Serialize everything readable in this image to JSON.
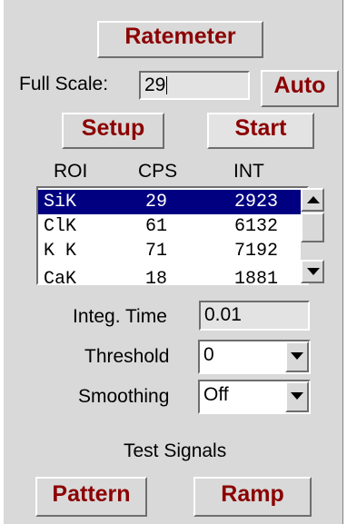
{
  "buttons": {
    "ratemeter": "Ratemeter",
    "auto": "Auto",
    "setup": "Setup",
    "start": "Start",
    "pattern": "Pattern",
    "ramp": "Ramp"
  },
  "full_scale": {
    "label": "Full Scale:",
    "value": "29"
  },
  "roi_table": {
    "headers": [
      "ROI",
      "CPS",
      "INT"
    ],
    "rows": [
      {
        "roi": "SiK",
        "cps": "29",
        "int": "2923",
        "selected": true
      },
      {
        "roi": "ClK",
        "cps": "61",
        "int": "6132"
      },
      {
        "roi": "K K",
        "cps": "71",
        "int": "7192"
      },
      {
        "roi": "CaK",
        "cps": "18",
        "int": "1881"
      }
    ]
  },
  "integ_time": {
    "label": "Integ. Time",
    "value": "0.01"
  },
  "threshold": {
    "label": "Threshold",
    "value": "0"
  },
  "smoothing": {
    "label": "Smoothing",
    "value": "Off"
  },
  "test_signals": {
    "label": "Test Signals"
  },
  "icons": {
    "scroll_up": "triangle-up-icon",
    "scroll_down": "triangle-down-icon",
    "dropdown": "triangle-down-icon"
  },
  "colors": {
    "panel": "#d9d9d9",
    "button_text": "#8b0000",
    "selection": "#000080"
  }
}
